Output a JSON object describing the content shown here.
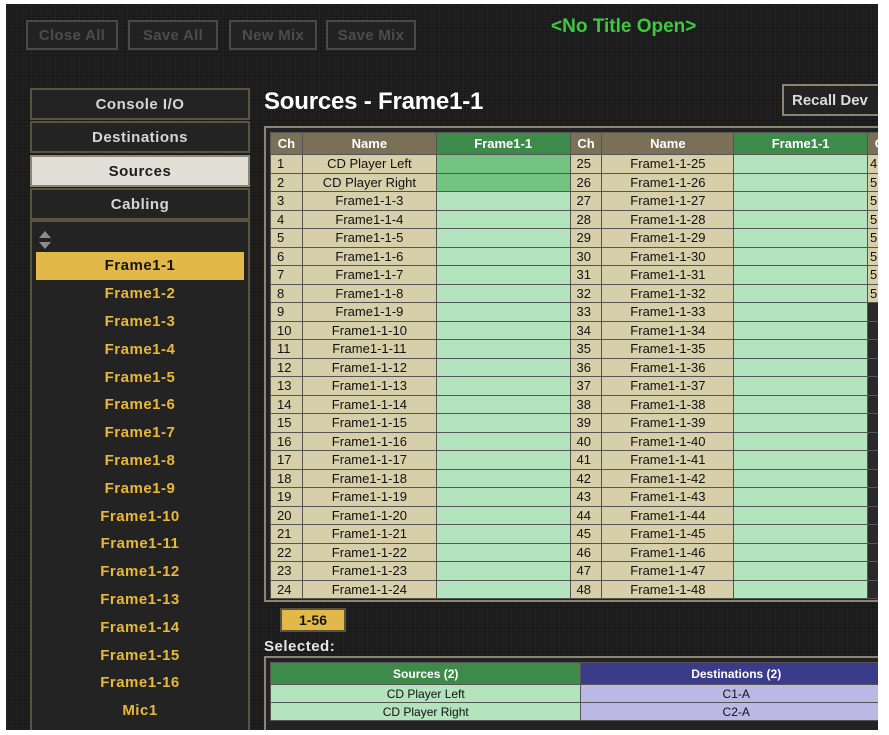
{
  "toolbar": {
    "close_all": "Close All",
    "save_all": "Save All",
    "new_mix": "New Mix",
    "save_mix": "Save Mix",
    "title": "<No Title Open>"
  },
  "nav": {
    "console_io": "Console I/O",
    "destinations": "Destinations",
    "sources": "Sources",
    "cabling": "Cabling"
  },
  "frames": [
    "Frame1-1",
    "Frame1-2",
    "Frame1-3",
    "Frame1-4",
    "Frame1-5",
    "Frame1-6",
    "Frame1-7",
    "Frame1-8",
    "Frame1-9",
    "Frame1-10",
    "Frame1-11",
    "Frame1-12",
    "Frame1-13",
    "Frame1-14",
    "Frame1-15",
    "Frame1-16",
    "Mic1"
  ],
  "selected_frame": "Frame1-1",
  "main": {
    "title": "Sources - Frame1-1",
    "recall_button": "Recall Dev",
    "headers": {
      "ch": "Ch",
      "name": "Name",
      "signal": "Frame1-1",
      "ch3": "C"
    },
    "left_rows": [
      {
        "ch": "1",
        "name": "CD Player Left",
        "on": true
      },
      {
        "ch": "2",
        "name": "CD Player Right",
        "on": true
      },
      {
        "ch": "3",
        "name": "Frame1-1-3"
      },
      {
        "ch": "4",
        "name": "Frame1-1-4"
      },
      {
        "ch": "5",
        "name": "Frame1-1-5"
      },
      {
        "ch": "6",
        "name": "Frame1-1-6"
      },
      {
        "ch": "7",
        "name": "Frame1-1-7"
      },
      {
        "ch": "8",
        "name": "Frame1-1-8"
      },
      {
        "ch": "9",
        "name": "Frame1-1-9"
      },
      {
        "ch": "10",
        "name": "Frame1-1-10"
      },
      {
        "ch": "11",
        "name": "Frame1-1-11"
      },
      {
        "ch": "12",
        "name": "Frame1-1-12"
      },
      {
        "ch": "13",
        "name": "Frame1-1-13"
      },
      {
        "ch": "14",
        "name": "Frame1-1-14"
      },
      {
        "ch": "15",
        "name": "Frame1-1-15"
      },
      {
        "ch": "16",
        "name": "Frame1-1-16"
      },
      {
        "ch": "17",
        "name": "Frame1-1-17"
      },
      {
        "ch": "18",
        "name": "Frame1-1-18"
      },
      {
        "ch": "19",
        "name": "Frame1-1-19"
      },
      {
        "ch": "20",
        "name": "Frame1-1-20"
      },
      {
        "ch": "21",
        "name": "Frame1-1-21"
      },
      {
        "ch": "22",
        "name": "Frame1-1-22"
      },
      {
        "ch": "23",
        "name": "Frame1-1-23"
      },
      {
        "ch": "24",
        "name": "Frame1-1-24"
      }
    ],
    "right_rows": [
      {
        "ch": "25",
        "name": "Frame1-1-25"
      },
      {
        "ch": "26",
        "name": "Frame1-1-26"
      },
      {
        "ch": "27",
        "name": "Frame1-1-27"
      },
      {
        "ch": "28",
        "name": "Frame1-1-28"
      },
      {
        "ch": "29",
        "name": "Frame1-1-29"
      },
      {
        "ch": "30",
        "name": "Frame1-1-30"
      },
      {
        "ch": "31",
        "name": "Frame1-1-31"
      },
      {
        "ch": "32",
        "name": "Frame1-1-32"
      },
      {
        "ch": "33",
        "name": "Frame1-1-33"
      },
      {
        "ch": "34",
        "name": "Frame1-1-34"
      },
      {
        "ch": "35",
        "name": "Frame1-1-35"
      },
      {
        "ch": "36",
        "name": "Frame1-1-36"
      },
      {
        "ch": "37",
        "name": "Frame1-1-37"
      },
      {
        "ch": "38",
        "name": "Frame1-1-38"
      },
      {
        "ch": "39",
        "name": "Frame1-1-39"
      },
      {
        "ch": "40",
        "name": "Frame1-1-40"
      },
      {
        "ch": "41",
        "name": "Frame1-1-41"
      },
      {
        "ch": "42",
        "name": "Frame1-1-42"
      },
      {
        "ch": "43",
        "name": "Frame1-1-43"
      },
      {
        "ch": "44",
        "name": "Frame1-1-44"
      },
      {
        "ch": "45",
        "name": "Frame1-1-45"
      },
      {
        "ch": "46",
        "name": "Frame1-1-46"
      },
      {
        "ch": "47",
        "name": "Frame1-1-47"
      },
      {
        "ch": "48",
        "name": "Frame1-1-48"
      }
    ],
    "third_col": [
      "4",
      "5",
      "5",
      "5",
      "5",
      "5",
      "5",
      "5"
    ],
    "page_tab": "1-56"
  },
  "selected": {
    "label": "Selected:",
    "sources_header": "Sources (2)",
    "destinations_header": "Destinations (2)",
    "rows": [
      {
        "source": "CD Player Left",
        "destination": "C1-A"
      },
      {
        "source": "CD Player Right",
        "destination": "C2-A"
      }
    ]
  },
  "colors": {
    "frame_accent": "#e2b848",
    "title_green": "#3ec83e",
    "signal_on": "#73c382",
    "signal_off": "#b4e4bd",
    "row_tan": "#d6cfa9",
    "dest_purple": "#3b3b8c"
  }
}
